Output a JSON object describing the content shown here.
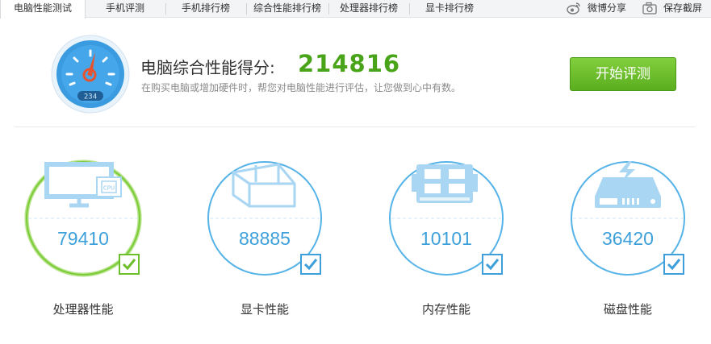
{
  "tabs": [
    {
      "label": "电脑性能测试",
      "active": true
    },
    {
      "label": "手机评测"
    },
    {
      "label": "手机排行榜"
    },
    {
      "label": "综合性能排行榜"
    },
    {
      "label": "处理器排行榜"
    },
    {
      "label": "显卡排行榜"
    }
  ],
  "toolbar": {
    "weibo_share": "微博分享",
    "save_screenshot": "保存截屏"
  },
  "header": {
    "score_label": "电脑综合性能得分:",
    "score_value": "214816",
    "gauge_readout": "234",
    "subtitle": "在购买电脑或增加硬件时，帮您对电脑性能进行评估，让您做到心中有数。",
    "start_button": "开始评测"
  },
  "components": [
    {
      "name": "处理器性能",
      "score": "79410",
      "icon": "cpu-monitor-icon",
      "status": "checked",
      "highlight": true
    },
    {
      "name": "显卡性能",
      "score": "88885",
      "icon": "graphics-card-icon",
      "status": "checked"
    },
    {
      "name": "内存性能",
      "score": "10101",
      "icon": "memory-chip-icon",
      "status": "checked"
    },
    {
      "name": "磁盘性能",
      "score": "36420",
      "icon": "hard-disk-icon",
      "status": "checked"
    }
  ],
  "colors": {
    "accent_blue": "#3ea0db",
    "accent_green": "#4aa41a",
    "button_green": "#6cbf2b"
  }
}
